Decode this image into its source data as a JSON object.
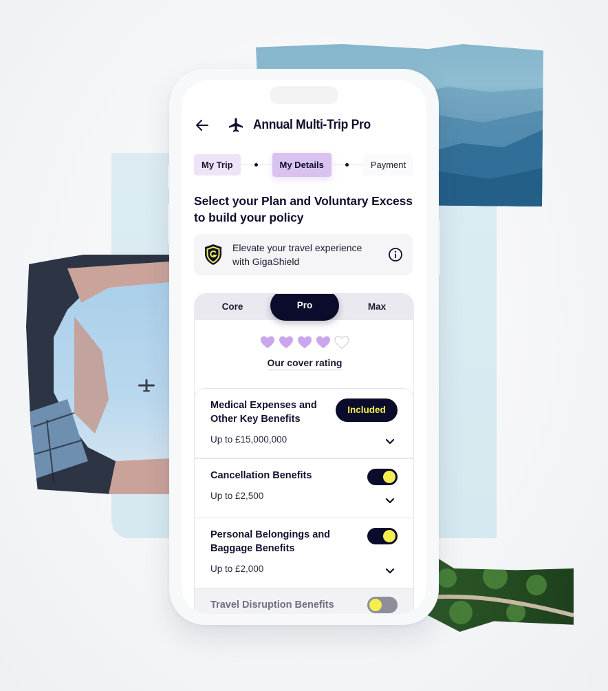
{
  "header": {
    "back_icon": "arrow-left-icon",
    "plan_icon": "airplane-icon",
    "title": "Annual Multi-Trip Pro"
  },
  "stepper": {
    "steps": [
      {
        "label": "My Trip",
        "state": "done"
      },
      {
        "label": "My Details",
        "state": "active"
      },
      {
        "label": "Payment",
        "state": "todo"
      }
    ]
  },
  "heading": "Select your Plan and Voluntary Excess to build your policy",
  "promo": {
    "icon": "shield-g-icon",
    "text": "Elevate your travel experience with GigaShield",
    "info_icon": "info-circle-icon"
  },
  "plans": {
    "tabs": [
      "Core",
      "Pro",
      "Max"
    ],
    "selected": "Pro",
    "rating": {
      "value": 4,
      "max": 5,
      "label": "Our cover rating"
    }
  },
  "benefits": [
    {
      "title": "Medical Expenses and Other Key Benefits",
      "amount": "Up to £15,000,000",
      "status": "included",
      "badge": "Included"
    },
    {
      "title": "Cancellation Benefits",
      "amount": "Up to £2,500",
      "status": "on"
    },
    {
      "title": "Personal Belongings and Baggage Benefits",
      "amount": "Up to £2,000",
      "status": "on"
    },
    {
      "title": "Travel Disruption Benefits",
      "amount": "",
      "status": "off"
    }
  ],
  "colors": {
    "brand_dark": "#0b0b2b",
    "accent_yellow": "#f4ef4e",
    "accent_purple": "#c9a6ee",
    "step_active": "#d9c2f0"
  }
}
